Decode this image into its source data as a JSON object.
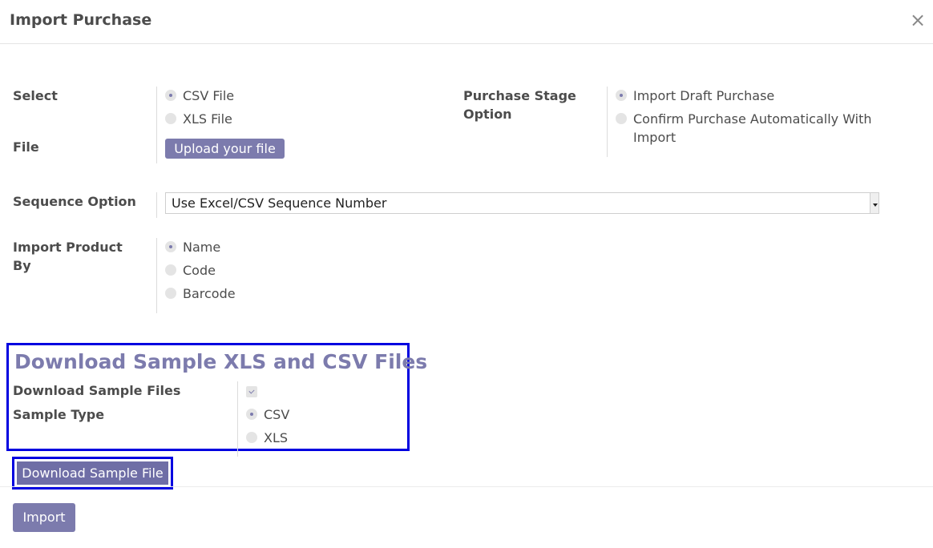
{
  "dialog": {
    "title": "Import Purchase",
    "close_glyph": "×"
  },
  "form": {
    "select_label": "Select",
    "file_label": "File",
    "file_types": [
      {
        "label": "CSV File",
        "selected": true
      },
      {
        "label": "XLS File",
        "selected": false
      }
    ],
    "upload_label": "Upload your file",
    "stage_label_line1": "Purchase Stage",
    "stage_label_line2": "Option",
    "stage_options": [
      {
        "label": "Import Draft Purchase",
        "selected": true
      },
      {
        "label_line1": "Confirm Purchase Automatically With",
        "label_line2": "Import",
        "selected": false
      }
    ],
    "sequence_label": "Sequence Option",
    "sequence_value": "Use Excel/CSV Sequence Number",
    "product_label_line1": "Import Product",
    "product_label_line2": "By",
    "product_options": [
      {
        "label": "Name",
        "selected": true
      },
      {
        "label": "Code",
        "selected": false
      },
      {
        "label": "Barcode",
        "selected": false
      }
    ]
  },
  "sample": {
    "title": "Download Sample XLS and CSV Files",
    "download_files_label": "Download Sample Files",
    "download_files_checked": true,
    "type_label": "Sample Type",
    "type_options": [
      {
        "label": "CSV",
        "selected": true
      },
      {
        "label": "XLS",
        "selected": false
      }
    ],
    "download_button": "Download Sample File"
  },
  "footer": {
    "import_button": "Import"
  },
  "colors": {
    "accent": "#7c7bad",
    "highlight": "#0000e0",
    "text": "#4c4c4c"
  }
}
